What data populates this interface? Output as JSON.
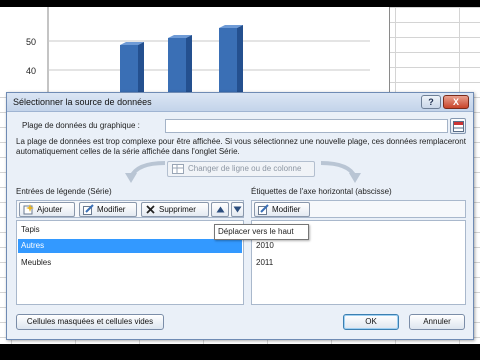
{
  "chart": {
    "y_ticks": [
      "50",
      "40"
    ],
    "bar_color": "#3a6fb5"
  },
  "dialog": {
    "title": "Sélectionner la source de données",
    "help_label": "?",
    "close_label": "X",
    "range_label": "Plage de données du graphique :",
    "range_value": "",
    "info_text": "La plage de données est trop complexe pour être affichée. Si vous sélectionnez une nouvelle plage, ces données remplaceront automatiquement celles de la série affichée dans l'onglet Série.",
    "switch_label": "Changer de ligne ou de colonne",
    "legend_panel": {
      "title": "Entrées de légende (Série)",
      "add_label": "Ajouter",
      "edit_label": "Modifier",
      "delete_label": "Supprimer",
      "items": [
        {
          "label": "Tapis"
        },
        {
          "label": "Autres"
        },
        {
          "label": "Meubles"
        }
      ],
      "selected_index": 1
    },
    "axis_panel": {
      "title": "Étiquettes de l'axe horizontal (abscisse)",
      "edit_label": "Modifier",
      "items": [
        {
          "label": "2010"
        },
        {
          "label": "2011"
        }
      ]
    },
    "tooltip": "Déplacer vers le haut",
    "hidden_cells_label": "Cellules masquées et cellules vides",
    "ok_label": "OK",
    "cancel_label": "Annuler"
  }
}
